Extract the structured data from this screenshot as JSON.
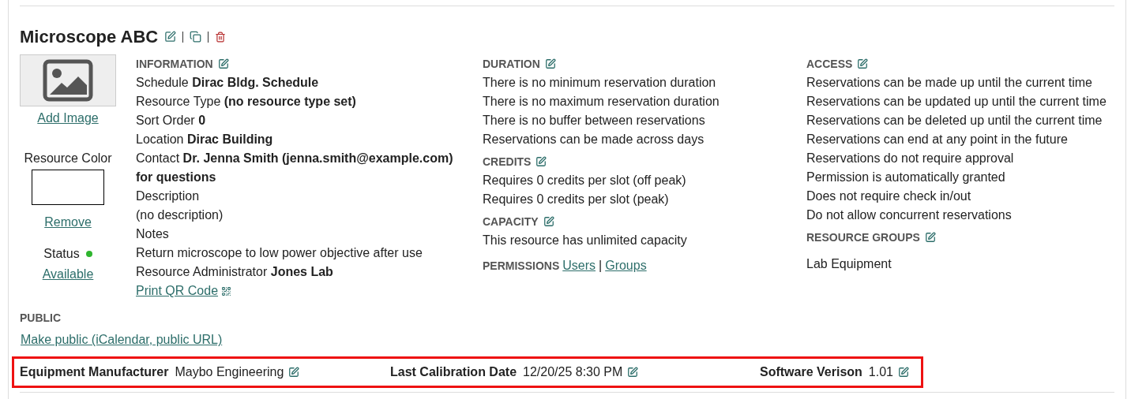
{
  "resource": {
    "title": "Microscope ABC"
  },
  "sidebar": {
    "add_image": "Add Image",
    "color_label": "Resource Color",
    "remove": "Remove",
    "status_label": "Status",
    "status_dot": {
      "color": "#2fb52f"
    },
    "status": "Available"
  },
  "information": {
    "heading": "INFORMATION",
    "lines": [
      "Schedule **Dirac Bldg. Schedule**",
      "Resource Type **(no resource type set)**",
      "Sort Order **0**",
      "Location **Dirac Building**",
      "Contact **Dr. Jenna Smith (jenna.smith@example.com) for questions**",
      "Description",
      "(no description)",
      "Notes",
      "Return microscope to low power objective after use",
      "Resource Administrator **Jones Lab**"
    ],
    "qr_link": "Print QR Code"
  },
  "duration": {
    "heading": "DURATION",
    "lines": [
      "There is no minimum reservation duration",
      "There is no maximum reservation duration",
      "There is no buffer between reservations",
      "Reservations can be made across days"
    ]
  },
  "credits": {
    "heading": "CREDITS",
    "lines": [
      "Requires 0 credits per slot (off peak)",
      "Requires 0 credits per slot (peak)"
    ]
  },
  "capacity": {
    "heading": "CAPACITY",
    "lines": [
      "This resource has unlimited capacity"
    ]
  },
  "permissions": {
    "heading": "PERMISSIONS",
    "links": [
      "Users",
      "Groups"
    ],
    "separator": "|"
  },
  "access": {
    "heading": "ACCESS",
    "lines": [
      "Reservations can be made up until the current time",
      "Reservations can be updated up until the current time",
      "Reservations can be deleted up until the current time",
      "Reservations can end at any point in the future",
      "Reservations do not require approval",
      "Permission is automatically granted",
      "Does not require check in/out",
      "Do not allow concurrent reservations"
    ]
  },
  "resource_groups": {
    "heading": "RESOURCE GROUPS",
    "items": [
      "Lab Equipment"
    ]
  },
  "public": {
    "heading": "PUBLIC",
    "link": "Make public (iCalendar, public URL)"
  },
  "attributes": [
    {
      "label": "Equipment Manufacturer",
      "value": "Maybo Engineering"
    },
    {
      "label": "Last Calibration Date",
      "value": "12/20/25 8:30 PM"
    },
    {
      "label": "Software Verison",
      "value": "1.01"
    }
  ]
}
